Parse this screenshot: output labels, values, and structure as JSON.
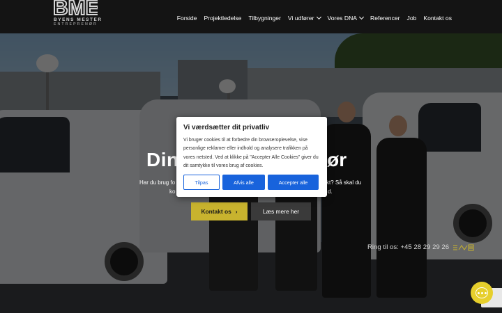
{
  "brand": {
    "logo_letters": "BME",
    "logo_line1": "BYENS MESTER",
    "logo_line2": "ENTREPRENØR"
  },
  "nav": {
    "items": [
      {
        "label": "Forside"
      },
      {
        "label": "Projektledelse"
      },
      {
        "label": "Tilbygninger"
      },
      {
        "label": "Vi udfører",
        "dropdown": true
      },
      {
        "label": "Vores DNA",
        "dropdown": true
      },
      {
        "label": "Referencer"
      },
      {
        "label": "Job"
      },
      {
        "label": "Kontakt os"
      }
    ]
  },
  "hero": {
    "title_start": "Din",
    "title_end": "nør",
    "sub_left": "Har du brug fo",
    "sub_right": "kt? Så skal du",
    "sub2_left": "ko",
    "sub2_right": "d.",
    "contact_button": "Kontakt os",
    "more_button": "Læs mere her",
    "phone": "Ring til os: +45 28 29 29 26"
  },
  "cookie": {
    "title": "Vi værdsætter dit privatliv",
    "text": "Vi bruger cookies til at forbedre din browseroplevelse, vise personlige reklamer eller indhold og analysere trafikken på vores netsted. Ved at klikke på \"Accepter Alle Cookies\" giver du dit samtykke til vores brug af cookies.",
    "customize": "Tilpas",
    "reject": "Afvis alle",
    "accept": "Accepter alle"
  },
  "colors": {
    "accent_yellow": "#c8b32e",
    "cookie_blue": "#1863dc",
    "header_bg": "#141414"
  },
  "icons": {
    "chat": "chat-bubble-icon",
    "arrow": "chevron-right-icon",
    "van": "van-icon"
  }
}
